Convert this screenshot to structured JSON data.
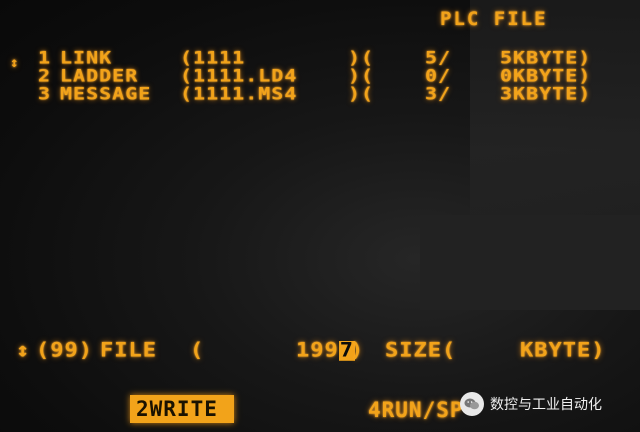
{
  "screen": {
    "title": "PLC FILE",
    "cursor_marker": "↕"
  },
  "files": [
    {
      "no": "1",
      "name": "LINK",
      "path": "(1111",
      "sep": ")(",
      "count": "5/",
      "size": "5KBYTE)"
    },
    {
      "no": "2",
      "name": "LADDER",
      "path": "(1111.LD4",
      "sep": ")(",
      "count": "0/",
      "size": "0KBYTE)"
    },
    {
      "no": "3",
      "name": "MESSAGE",
      "path": "(1111.MS4",
      "sep": ")(",
      "count": "3/",
      "size": "3KBYTE)"
    }
  ],
  "input_line": {
    "marker": "↕",
    "count": "(99)",
    "file_label": "FILE",
    "open_paren": "(",
    "value_prefix": "199",
    "value_cursor": "7",
    "close_paren": ")",
    "size_label": "SIZE(",
    "unit_label": "KBYTE)"
  },
  "softkeys": {
    "write": "2WRITE",
    "run": "4RUN/SP"
  },
  "watermark": {
    "text": "数控与工业自动化"
  },
  "colors": {
    "phosphor": "#f2a31a",
    "background": "#0b0b0b"
  }
}
